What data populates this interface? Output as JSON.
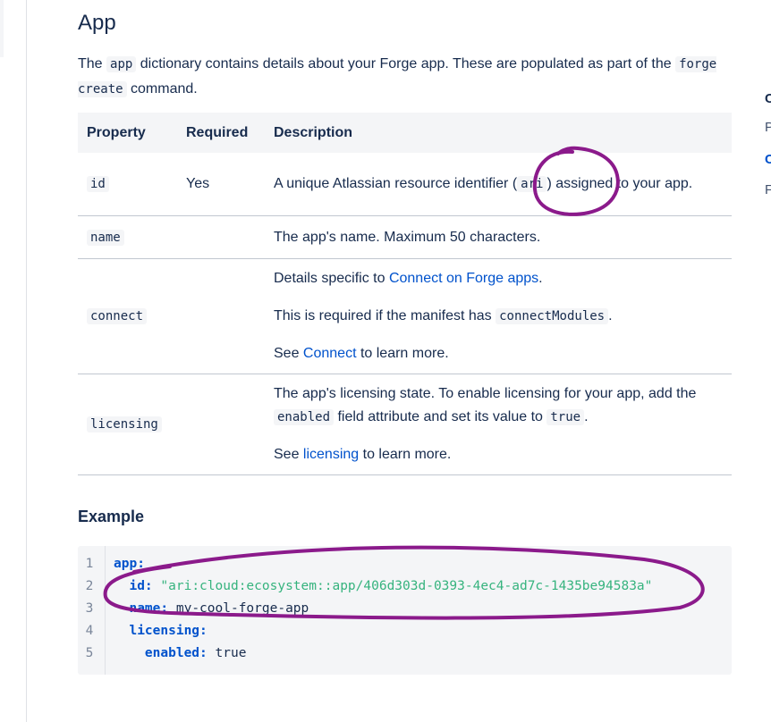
{
  "section": {
    "title": "App",
    "intro_parts": [
      "The ",
      "app",
      " dictionary contains details about your Forge app. These are populated as part of the ",
      "forge create",
      " command."
    ]
  },
  "table": {
    "headers": [
      "Property",
      "Required",
      "Description"
    ],
    "rows": {
      "id": {
        "property": "id",
        "required": "Yes",
        "desc_a": "A unique Atlassian resource identifier (",
        "desc_code": "ari",
        "desc_b": ") assigned to your app."
      },
      "name": {
        "property": "name",
        "required": "",
        "desc": "The app's name. Maximum 50 characters."
      },
      "connect": {
        "property": "connect",
        "required": "",
        "p1_a": "Details specific to ",
        "p1_link": "Connect on Forge apps",
        "p1_b": ".",
        "p2_a": "This is required if the manifest has ",
        "p2_code": "connectModules",
        "p2_b": ".",
        "p3_a": "See ",
        "p3_link": "Connect",
        "p3_b": " to learn more."
      },
      "licensing": {
        "property": "licensing",
        "required": "",
        "p1_a": "The app's licensing state. To enable licensing for your app, add the ",
        "p1_code1": "enabled",
        "p1_b": " field attribute and set its value to ",
        "p1_code2": "true",
        "p1_c": ".",
        "p2_a": "See ",
        "p2_link": "licensing",
        "p2_b": " to learn more."
      }
    }
  },
  "example": {
    "title": "Example",
    "line_numbers": [
      "1",
      "2",
      "3",
      "4",
      "5"
    ],
    "lines": {
      "l1_key": "app:",
      "l2_key": "id:",
      "l2_val": "\"ari:cloud:ecosystem::app/406d303d-0393-4ec4-ad7c-1435be94583a\"",
      "l3_key": "name:",
      "l3_val": "my-cool-forge-app",
      "l4_key": "licensing:",
      "l5_key": "enabled:",
      "l5_val": "true"
    }
  },
  "right_rail_fragments": [
    "C",
    "P",
    "C",
    "F"
  ],
  "colors": {
    "text": "#172b4d",
    "link": "#0052cc",
    "header_bg": "#f4f5f7",
    "code_string": "#36b37e",
    "annotation": "#8b1a8b"
  }
}
